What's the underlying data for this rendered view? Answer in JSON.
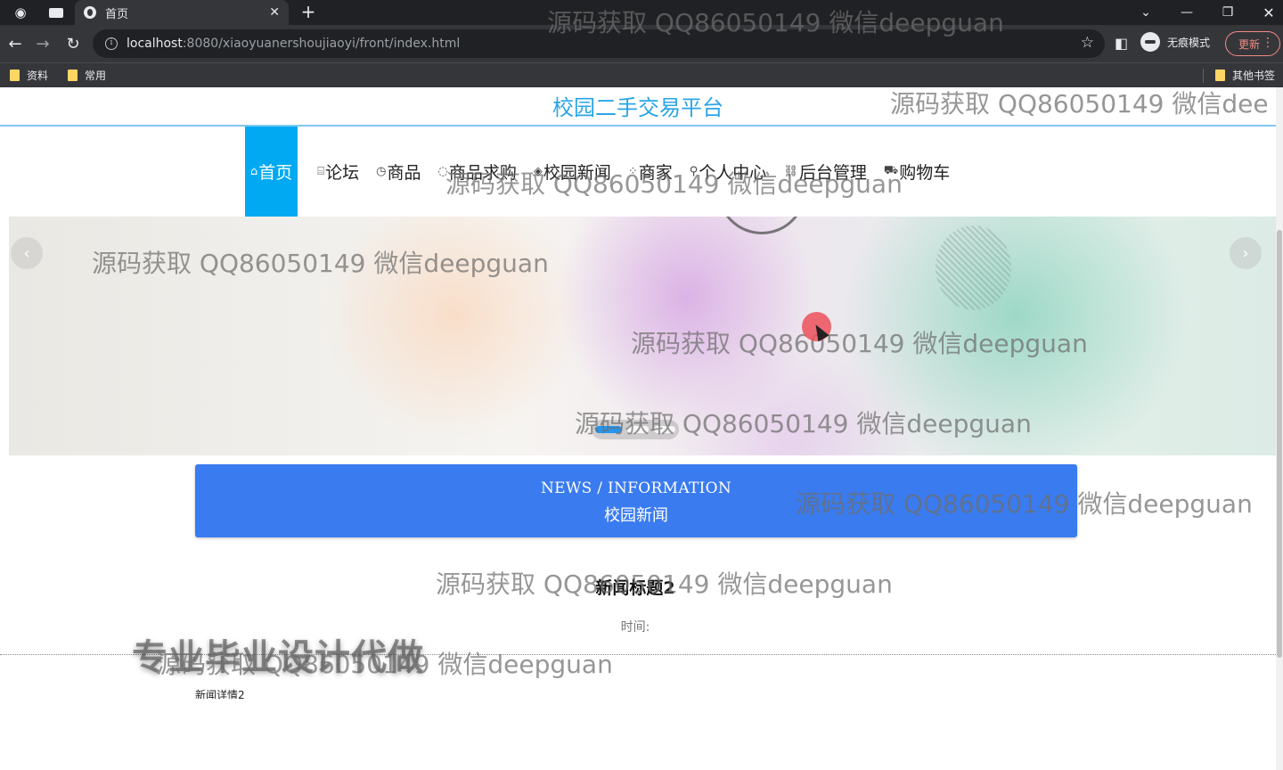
{
  "browser": {
    "tab_title": "首页",
    "url_host": "localhost",
    "url_path": ":8080/xiaoyuanershoujiaoyi/front/index.html",
    "incognito_label": "无痕模式",
    "update_label": "更新",
    "bookmarks": [
      "资料",
      "常用"
    ],
    "other_bookmarks": "其他书签"
  },
  "site": {
    "title": "校园二手交易平台",
    "nav": [
      {
        "icon": "⌂",
        "label": "首页"
      },
      {
        "icon": "⌸",
        "label": "论坛"
      },
      {
        "icon": "◷",
        "label": "商品"
      },
      {
        "icon": "◌",
        "label": "商品求购"
      },
      {
        "icon": "◈",
        "label": "校园新闻"
      },
      {
        "icon": "⁘",
        "label": "商家"
      },
      {
        "icon": "⚲",
        "label": "个人中心"
      },
      {
        "icon": "⛓",
        "label": "后台管理"
      },
      {
        "icon": "⛟",
        "label": "购物车"
      }
    ]
  },
  "news_section": {
    "heading_en": "NEWS / INFORMATION",
    "heading_cn": "校园新闻",
    "article_title": "新闻标题2",
    "time_label": "时间:",
    "detail": "新闻详情2"
  },
  "overlay": {
    "watermark": "源码获取 QQ86050149 微信deepguan",
    "watermark_partial": "源码获取 QQ86050149 微信dee",
    "big_watermark": "专业毕业设计代做"
  }
}
